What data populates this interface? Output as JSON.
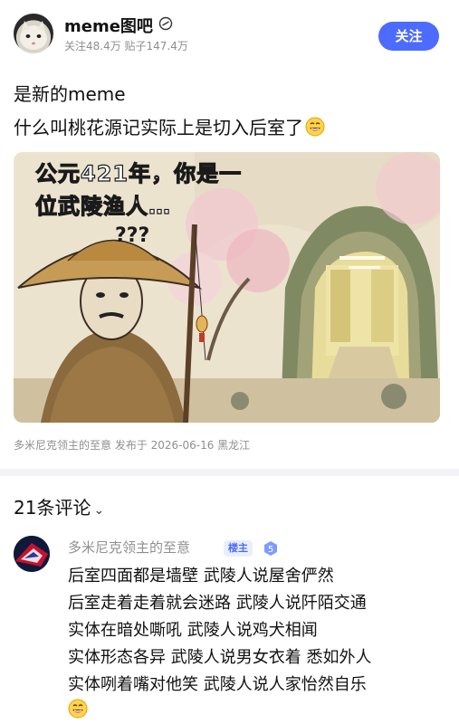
{
  "forum": {
    "name": "meme图吧",
    "stats": "关注48.4万 贴子147.4万",
    "follow_label": "关注"
  },
  "post": {
    "title": "是新的meme",
    "body": "什么叫桃花源记实际上是切入后室了",
    "image": {
      "caption_line1": "公元421年，你是一",
      "caption_line2": "位武陵渔人…",
      "question_marks": "???"
    },
    "meta": "多米尼克领主的至意 发布于 2026-06-16 黑龙江"
  },
  "comments": {
    "header": "21条评论",
    "chevron": "⌄",
    "items": [
      {
        "author": "多米尼克领主的至意",
        "badge": "楼主",
        "level": "5",
        "lines": [
          "后室四面都是墙壁 武陵人说屋舍俨然",
          "后室走着走着就会迷路 武陵人说阡陌交通",
          "实体在暗处嘶吼 武陵人说鸡犬相闻",
          "实体形态各异 武陵人说男女衣着 悉如外人",
          "实体咧着嘴对他笑 武陵人说人家怡然自乐"
        ]
      }
    ]
  },
  "colors": {
    "accent": "#4d6bfe",
    "meta_gray": "#8f8f8f"
  }
}
